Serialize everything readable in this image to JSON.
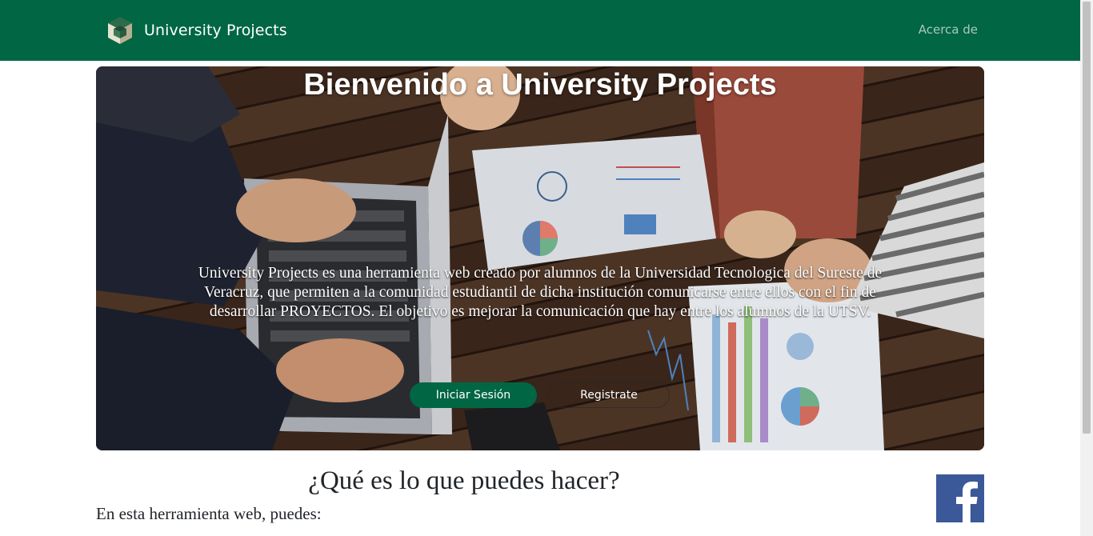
{
  "navbar": {
    "brand": "University Projects",
    "about_link": "Acerca de",
    "logo_icon": "cube-logo-icon"
  },
  "hero": {
    "title": "Bienvenido a University Projects",
    "description": "University Projects es una herramienta web creado por alumnos de la Universidad Tecnologica del Sureste de Veracruz, que permiten a la comunidad estudiantil de dicha institución comunicarse entre ellos con el fin de desarrollar PROYECTOS. El objetivo es mejorar la comunicación que hay entre los alumnos de la UTSV.",
    "login_button": "Iniciar Sesión",
    "register_button": "Registrate"
  },
  "section": {
    "title": "¿Qué es lo que puedes hacer?",
    "intro": "En esta herramienta web, puedes:"
  },
  "social": {
    "facebook_icon": "facebook-icon"
  },
  "colors": {
    "primary": "#006644",
    "facebook": "#3b5998",
    "nav_link": "#a9c9bc"
  }
}
